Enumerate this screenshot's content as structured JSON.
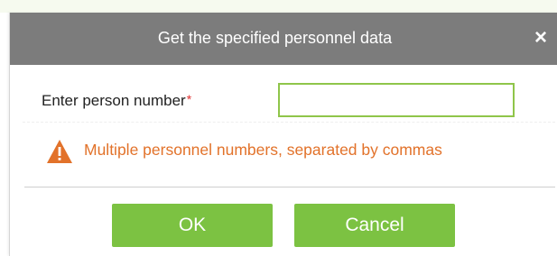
{
  "dialog": {
    "title": "Get the specified personnel data",
    "close_glyph": "×"
  },
  "form": {
    "label": "Enter person number",
    "required_marker": "*",
    "input_value": "",
    "input_placeholder": ""
  },
  "hint": {
    "icon": "warning-icon",
    "text": "Multiple personnel numbers, separated by commas"
  },
  "buttons": {
    "ok_label": "OK",
    "cancel_label": "Cancel"
  },
  "colors": {
    "title_bar": "#7c7c7c",
    "accent_green": "#7cc242",
    "input_border": "#8fc54a",
    "warning_orange": "#e2722a",
    "required_red": "#e03030"
  }
}
